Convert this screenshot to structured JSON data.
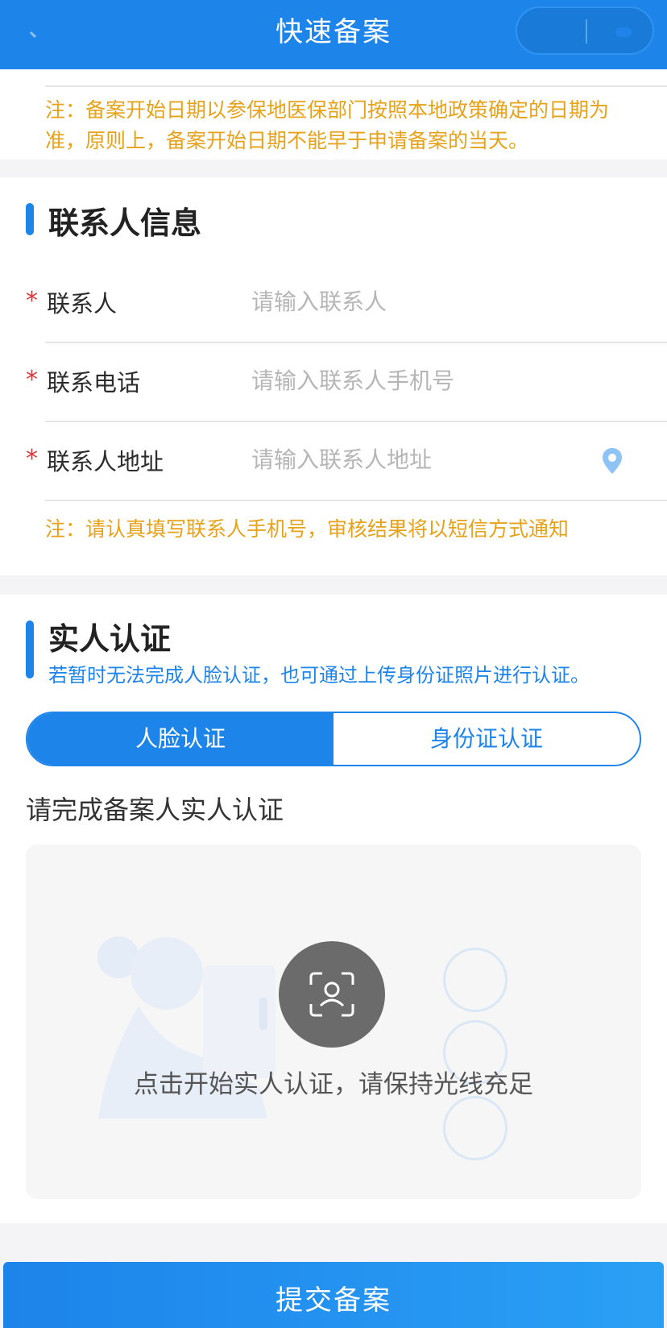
{
  "header": {
    "title": "快速备案"
  },
  "date_note": "注：备案开始日期以参保地医保部门按照本地政策确定的日期为准，原则上，备案开始日期不能早于申请备案的当天。",
  "contact": {
    "title": "联系人信息",
    "fields": [
      {
        "label": "联系人",
        "placeholder": "请输入联系人",
        "required_mark": "*"
      },
      {
        "label": "联系电话",
        "placeholder": "请输入联系人手机号",
        "required_mark": "*"
      },
      {
        "label": "联系人地址",
        "placeholder": "请输入联系人地址",
        "required_mark": "*",
        "icon": "location-pin-icon"
      }
    ],
    "note": "注：请认真填写联系人手机号，审核结果将以短信方式通知"
  },
  "auth": {
    "title": "实人认证",
    "subtitle": "若暂时无法完成人脸认证，也可通过上传身份证照片进行认证。",
    "tabs": [
      {
        "label": "人脸认证",
        "active": true
      },
      {
        "label": "身份证认证",
        "active": false
      }
    ],
    "prompt": "请完成备案人实人认证",
    "camera_icon": "face-scan-icon",
    "hint": "点击开始实人认证，请保持光线充足"
  },
  "submit_label": "提交备案",
  "colors": {
    "primary": "#1d84ea",
    "note": "#e6a21a",
    "required": "#e2333b"
  }
}
